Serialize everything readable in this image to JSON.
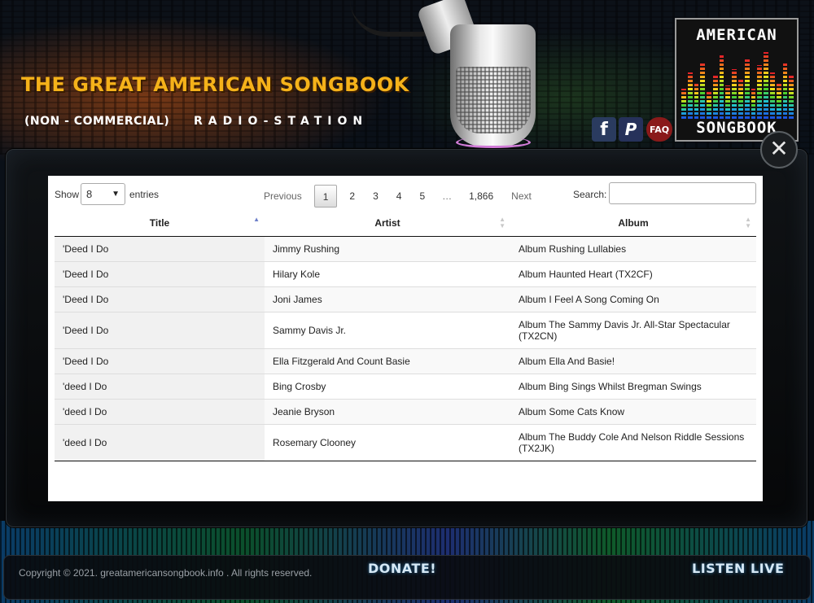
{
  "header": {
    "title": "THE GREAT AMERICAN SONGBOOK",
    "subtitle_left": "(NON - COMMERCIAL)",
    "subtitle_right": "RADIO-STATION",
    "social": {
      "facebook": "f",
      "paypal": "P",
      "faq": "FAQ"
    },
    "logo": {
      "top": "AMERICAN",
      "bottom": "SONGBOOK"
    }
  },
  "colors": {
    "title": "#f5b21a",
    "sort_active": "#6d7fc9"
  },
  "modal": {
    "close": "✕"
  },
  "table_controls": {
    "show_label": "Show",
    "page_length": "8",
    "entries_label": "entries",
    "search_label": "Search:",
    "search_value": "",
    "pagination": {
      "previous": "Previous",
      "pages": [
        "1",
        "2",
        "3",
        "4",
        "5"
      ],
      "ellipsis": "…",
      "last": "1,866",
      "next": "Next",
      "current": "1"
    }
  },
  "table": {
    "columns": [
      "Title",
      "Artist",
      "Album"
    ],
    "sorted_column": "Title",
    "sort_direction": "ascending",
    "rows": [
      {
        "title": "'Deed I Do",
        "artist": "Jimmy Rushing",
        "album": "Album Rushing Lullabies"
      },
      {
        "title": "'Deed I Do",
        "artist": "Hilary Kole",
        "album": "Album Haunted Heart (TX2CF)"
      },
      {
        "title": "'Deed I Do",
        "artist": "Joni James",
        "album": "Album I Feel A Song Coming On"
      },
      {
        "title": "'Deed I Do",
        "artist": "Sammy Davis Jr.",
        "album": "Album The Sammy Davis Jr. All-Star Spectacular (TX2CN)"
      },
      {
        "title": "'Deed I Do",
        "artist": "Ella Fitzgerald And Count Basie",
        "album": "Album Ella And Basie!"
      },
      {
        "title": "'deed I Do",
        "artist": "Bing Crosby",
        "album": "Album Bing Sings Whilst Bregman Swings"
      },
      {
        "title": "'deed I Do",
        "artist": "Jeanie Bryson",
        "album": "Album Some Cats Know"
      },
      {
        "title": "'deed I Do",
        "artist": "Rosemary Clooney",
        "album": "Album The Buddy Cole And Nelson Riddle Sessions (TX2JK)"
      }
    ]
  },
  "footer": {
    "copyright": "Copyright © 2021. greatamericansongbook.info . All rights reserved.",
    "donate": "DONATE!",
    "listen": "LISTEN LIVE"
  }
}
